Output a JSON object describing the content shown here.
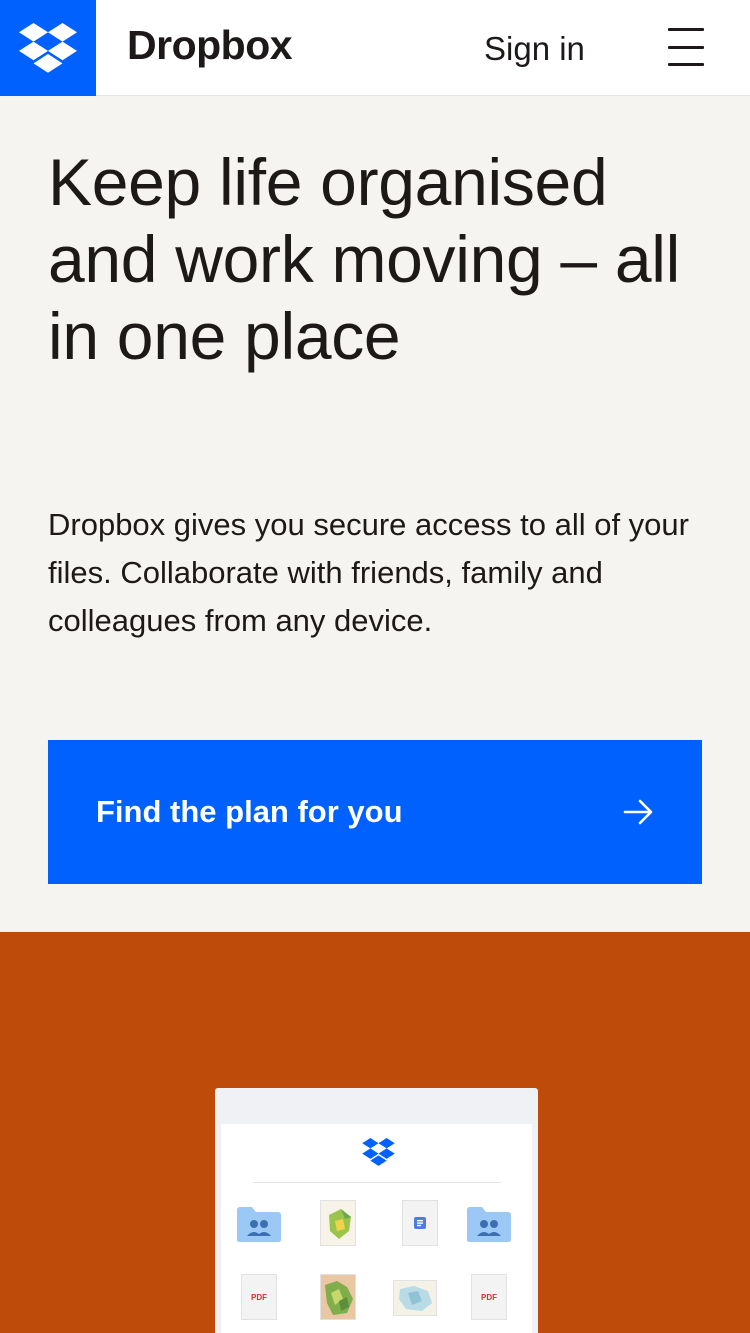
{
  "header": {
    "brand": "Dropbox",
    "sign_in": "Sign in",
    "menu_icon": "hamburger-menu-icon",
    "logo_icon": "dropbox-logo-icon"
  },
  "hero": {
    "title": "Keep life organised and work moving – all in one place",
    "description": "Dropbox gives you secure access to all of your files. Collaborate with friends, family and colleagues from any device.",
    "cta_label": "Find the plan for you",
    "cta_icon": "arrow-right-icon"
  },
  "preview": {
    "tiles": [
      {
        "kind": "shared-folder-icon"
      },
      {
        "kind": "map-thumbnail"
      },
      {
        "kind": "document-icon"
      },
      {
        "kind": "shared-folder-icon"
      },
      {
        "kind": "pdf-icon",
        "label": "PDF"
      },
      {
        "kind": "map-thumbnail"
      },
      {
        "kind": "map-thumbnail"
      },
      {
        "kind": "pdf-icon",
        "label": "PDF"
      }
    ]
  },
  "colors": {
    "accent": "#0061fe",
    "background": "#f5f4f1",
    "feature_band": "#be4b0a",
    "text": "#1e1919"
  }
}
